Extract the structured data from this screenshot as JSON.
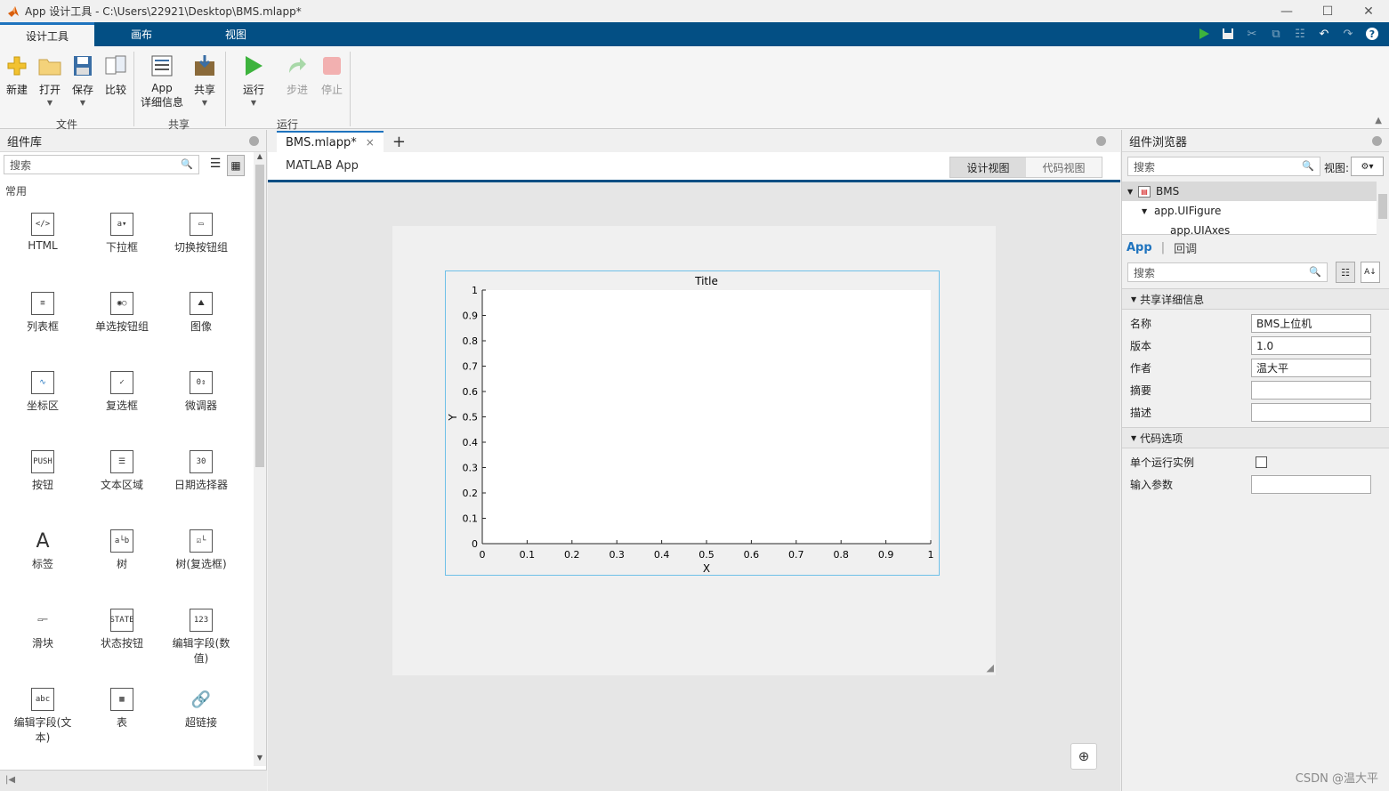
{
  "window": {
    "title": "App 设计工具 - C:\\Users\\22921\\Desktop\\BMS.mlapp*"
  },
  "tabs": [
    "设计工具",
    "画布",
    "视图"
  ],
  "ribbon": {
    "new": "新建",
    "open": "打开",
    "save": "保存",
    "compare": "比较",
    "app_details_1": "App",
    "app_details_2": "详细信息",
    "share": "共享",
    "run": "运行",
    "step": "步进",
    "stop": "停止",
    "group_file": "文件",
    "group_share": "共享",
    "group_run": "运行"
  },
  "library": {
    "title": "组件库",
    "search_placeholder": "搜索",
    "section": "常用",
    "items": [
      "HTML",
      "下拉框",
      "切换按钮组",
      "列表框",
      "单选按钮组",
      "图像",
      "坐标区",
      "复选框",
      "微调器",
      "按钮",
      "文本区域",
      "日期选择器",
      "标签",
      "树",
      "树(复选框)",
      "滑块",
      "状态按钮",
      "编辑字段(数值)",
      "编辑字段(文本)",
      "表",
      "超链接"
    ]
  },
  "doc": {
    "tab": "BMS.mlapp*",
    "close": "×",
    "add": "+",
    "app_title": "MATLAB App",
    "design_view": "设计视图",
    "code_view": "代码视图"
  },
  "chart_data": {
    "type": "line",
    "title": "Title",
    "xlabel": "X",
    "ylabel": "Y",
    "xlim": [
      0,
      1
    ],
    "ylim": [
      0,
      1
    ],
    "xticks": [
      "0",
      "0.1",
      "0.2",
      "0.3",
      "0.4",
      "0.5",
      "0.6",
      "0.7",
      "0.8",
      "0.9",
      "1"
    ],
    "yticks": [
      "0",
      "0.1",
      "0.2",
      "0.3",
      "0.4",
      "0.5",
      "0.6",
      "0.7",
      "0.8",
      "0.9",
      "1"
    ],
    "series": [],
    "grid": false
  },
  "browser": {
    "title": "组件浏览器",
    "search_placeholder": "搜索",
    "view_label": "视图:",
    "tree": [
      "BMS",
      "app.UIFigure",
      "app.UIAxes"
    ],
    "tab_app": "App",
    "tab_sep": "|",
    "tab_callback": "回调",
    "inspector_search": "搜索",
    "section_share": "共享详细信息",
    "section_code": "代码选项",
    "props": [
      {
        "label": "名称",
        "value": "BMS上位机"
      },
      {
        "label": "版本",
        "value": "1.0"
      },
      {
        "label": "作者",
        "value": "温大平"
      },
      {
        "label": "摘要",
        "value": ""
      },
      {
        "label": "描述",
        "value": ""
      }
    ],
    "single_instance": "单个运行实例",
    "input_args": "输入参数"
  },
  "watermark": "CSDN @温大平",
  "colors": {
    "tabbar": "#034f84",
    "accent": "#1e73be",
    "axes_border": "#6ec0e8"
  }
}
